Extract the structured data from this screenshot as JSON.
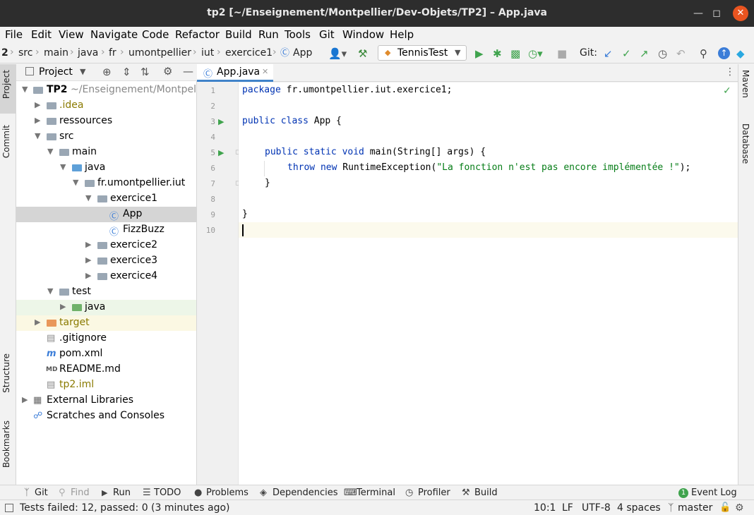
{
  "window": {
    "title": "tp2 [~/Enseignement/Montpellier/Dev-Objets/TP2] – App.java"
  },
  "menu": [
    "File",
    "Edit",
    "View",
    "Navigate",
    "Code",
    "Refactor",
    "Build",
    "Run",
    "Tools",
    "Git",
    "Window",
    "Help"
  ],
  "breadcrumb": {
    "root": "2",
    "items": [
      "src",
      "main",
      "java",
      "fr",
      "umontpellier",
      "iut",
      "exercice1"
    ],
    "file": "App"
  },
  "run_config": "TennisTest",
  "git_label": "Git:",
  "left_tabs": [
    "Project",
    "Commit",
    "Structure",
    "Bookmarks"
  ],
  "right_tabs": [
    "Maven",
    "Database"
  ],
  "project_panel": {
    "title": "Project",
    "tree": [
      {
        "label": "TP2",
        "suffix": "~/Enseignement/Montpellier/Dev-Objets/TP2"
      },
      {
        "label": ".idea"
      },
      {
        "label": "ressources"
      },
      {
        "label": "src"
      },
      {
        "label": "main"
      },
      {
        "label": "java"
      },
      {
        "label": "fr.umontpellier.iut"
      },
      {
        "label": "exercice1"
      },
      {
        "label": "App"
      },
      {
        "label": "FizzBuzz"
      },
      {
        "label": "exercice2"
      },
      {
        "label": "exercice3"
      },
      {
        "label": "exercice4"
      },
      {
        "label": "test"
      },
      {
        "label": "java"
      },
      {
        "label": "target"
      },
      {
        "label": ".gitignore"
      },
      {
        "label": "pom.xml"
      },
      {
        "label": "README.md"
      },
      {
        "label": "tp2.iml"
      },
      {
        "label": "External Libraries"
      },
      {
        "label": "Scratches and Consoles"
      }
    ]
  },
  "editor": {
    "tab": "App.java",
    "line_numbers": [
      "1",
      "2",
      "3",
      "4",
      "5",
      "6",
      "7",
      "8",
      "9",
      "10"
    ],
    "code": {
      "l1_kw": "package",
      "l1_rest": " fr.umontpellier.iut.exercice1;",
      "l3_kw": "public class",
      "l3_rest": " App {",
      "l5_kw": "public static void",
      "l5_rest": " main(String[] args) {",
      "l6_kw": "throw new",
      "l6_mid": " RuntimeException(",
      "l6_str": "\"La fonction n'est pas encore implémentée !\"",
      "l6_end": ");",
      "l7": "}",
      "l9": "}"
    }
  },
  "bottom_tools": [
    "Git",
    "Find",
    "Run",
    "TODO",
    "Problems",
    "Dependencies",
    "Terminal",
    "Profiler",
    "Build",
    "Event Log"
  ],
  "status": {
    "message": "Tests failed: 12, passed: 0 (3 minutes ago)",
    "position": "10:1",
    "line_sep": "LF",
    "encoding": "UTF-8",
    "indent": "4 spaces",
    "branch": "master"
  }
}
